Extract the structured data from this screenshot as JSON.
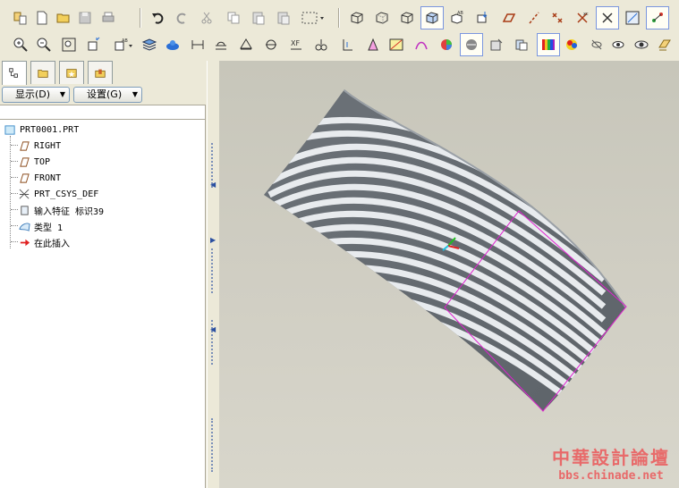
{
  "menu": {
    "display_label": "显示(D)",
    "settings_label": "设置(G)"
  },
  "model_tree": {
    "items": [
      {
        "label": "PRT0001.PRT",
        "icon": "part-icon"
      },
      {
        "label": "RIGHT",
        "icon": "datum-plane-icon"
      },
      {
        "label": "TOP",
        "icon": "datum-plane-icon"
      },
      {
        "label": "FRONT",
        "icon": "datum-plane-icon"
      },
      {
        "label": "PRT_CSYS_DEF",
        "icon": "csys-icon"
      },
      {
        "label": "输入特征 标识39",
        "icon": "import-feature-icon"
      },
      {
        "label": "类型 1",
        "icon": "surface-icon"
      },
      {
        "label": "在此插入",
        "icon": "insert-here-arrow-icon"
      }
    ]
  },
  "watermark": {
    "title": "中華設計論壇",
    "url": "bbs.chinade.net"
  },
  "colors": {
    "viewport_bg": "#cfcdc2",
    "surface_light": "#e8ebee",
    "surface_dark": "#6e747a",
    "selection_edge": "#e020d0",
    "watermark": "#e86a6a"
  }
}
